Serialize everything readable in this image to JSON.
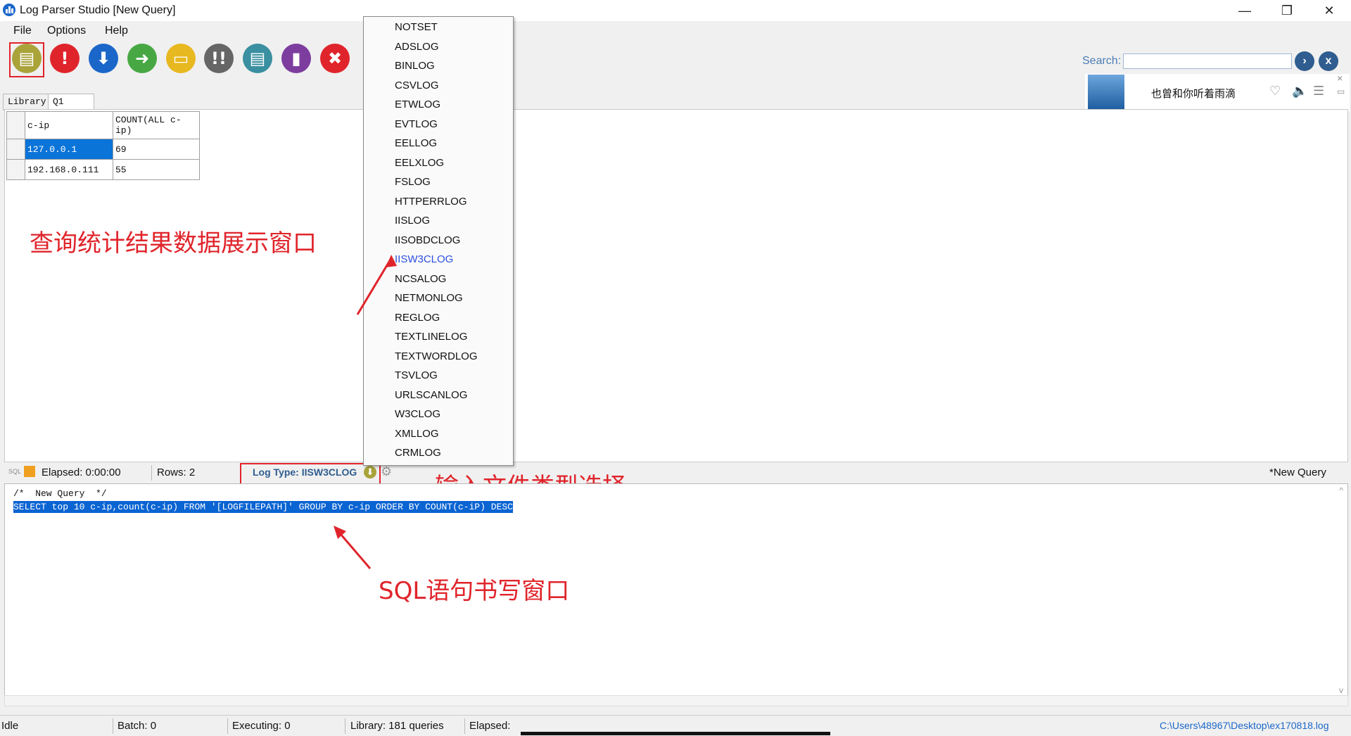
{
  "window": {
    "title": "Log Parser Studio  [New Query]",
    "minimize": "—",
    "restore": "❐",
    "close": "✕"
  },
  "menu": [
    "File",
    "Options",
    "Help"
  ],
  "toolbar_icons": [
    {
      "name": "new-query-icon",
      "glyph": "▤",
      "color": "#a9a33a"
    },
    {
      "name": "run-query-icon",
      "glyph": "!",
      "color": "#e0242b"
    },
    {
      "name": "download-icon",
      "glyph": "⬇",
      "color": "#1b67c9"
    },
    {
      "name": "forward-icon",
      "glyph": "➜",
      "color": "#47a843"
    },
    {
      "name": "open-folder-icon",
      "glyph": "▭",
      "color": "#e8b820"
    },
    {
      "name": "run-batch-icon",
      "glyph": "!!",
      "color": "#666666"
    },
    {
      "name": "document-icon",
      "glyph": "▤",
      "color": "#3a8fa0"
    },
    {
      "name": "chart-icon",
      "glyph": "▮",
      "color": "#7d3d9e"
    },
    {
      "name": "cancel-icon",
      "glyph": "✖",
      "color": "#e0242b"
    }
  ],
  "search": {
    "label": "Search:",
    "value": "",
    "go": "›",
    "clear": "x"
  },
  "music": {
    "title": "也曾和你听着雨滴",
    "heart": "♡",
    "volume": "🔈",
    "list": "☰",
    "close": "×",
    "min": "▭"
  },
  "tabs": [
    "Library",
    "Q1"
  ],
  "results": {
    "headers": [
      "c-ip",
      "COUNT(ALL c-ip)"
    ],
    "rows": [
      [
        "127.0.0.1",
        "69"
      ],
      [
        "192.168.0.111",
        "55"
      ]
    ]
  },
  "dropdown": {
    "items": [
      "NOTSET",
      "ADSLOG",
      "BINLOG",
      "CSVLOG",
      "ETWLOG",
      "EVTLOG",
      "EELLOG",
      "EELXLOG",
      "FSLOG",
      "HTTPERRLOG",
      "IISLOG",
      "IISOBDCLOG",
      "IISW3CLOG",
      "NCSALOG",
      "NETMONLOG",
      "REGLOG",
      "TEXTLINELOG",
      "TEXTWORDLOG",
      "TSVLOG",
      "URLSCANLOG",
      "W3CLOG",
      "XMLLOG",
      "CRMLOG"
    ],
    "selected": "IISW3CLOG"
  },
  "annotations": {
    "results_window": "查询统计结果数据展示窗口",
    "file_type": "输入文件类型选择",
    "sql_window": "SQL语句书写窗口"
  },
  "status": {
    "elapsed": "Elapsed: 0:00:00",
    "rows": "Rows: 2",
    "log_type": "Log Type: IISW3CLOG",
    "query_name": "*New Query"
  },
  "editor": {
    "line1": "/*  New Query  */",
    "line2": "SELECT top 10 c-ip,count(c-ip) FROM '[LOGFILEPATH]' GROUP BY c-ip ORDER BY COUNT(c-iP) DESC"
  },
  "bottom": {
    "state": "Idle",
    "batch": "Batch: 0",
    "executing": "Executing: 0",
    "library": "Library: 181 queries",
    "elapsed": "Elapsed:",
    "path": "C:\\Users\\48967\\Desktop\\ex170818.log"
  },
  "colors": {
    "accent": "#e0242b",
    "selection": "#0a74d8",
    "link": "#1b67c9"
  }
}
